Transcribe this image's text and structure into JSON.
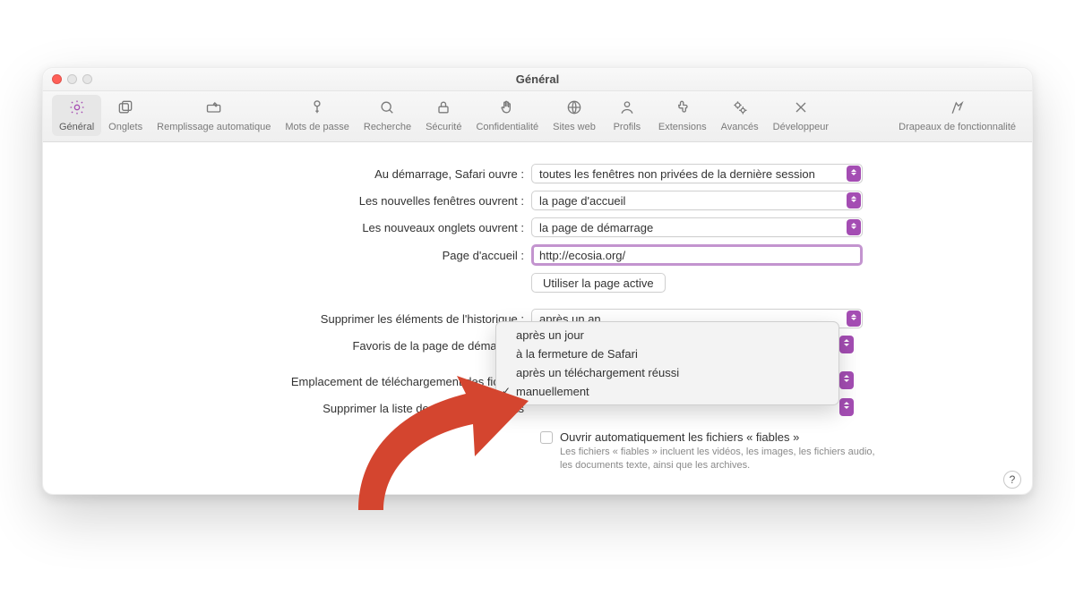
{
  "window": {
    "title": "Général"
  },
  "toolbar": {
    "items": [
      {
        "label": "Général"
      },
      {
        "label": "Onglets"
      },
      {
        "label": "Remplissage automatique"
      },
      {
        "label": "Mots de passe"
      },
      {
        "label": "Recherche"
      },
      {
        "label": "Sécurité"
      },
      {
        "label": "Confidentialité"
      },
      {
        "label": "Sites web"
      },
      {
        "label": "Profils"
      },
      {
        "label": "Extensions"
      },
      {
        "label": "Avancés"
      },
      {
        "label": "Développeur"
      },
      {
        "label": "Drapeaux de fonctionnalité"
      }
    ]
  },
  "settings": {
    "startup_label": "Au démarrage, Safari ouvre :",
    "startup_value": "toutes les fenêtres non privées de la dernière session",
    "new_windows_label": "Les nouvelles fenêtres ouvrent :",
    "new_windows_value": "la page d'accueil",
    "new_tabs_label": "Les nouveaux onglets ouvrent :",
    "new_tabs_value": "la page de démarrage",
    "homepage_label": "Page d'accueil :",
    "homepage_value": "http://ecosia.org/",
    "use_current_btn": "Utiliser la page active",
    "history_label": "Supprimer les éléments de l'historique :",
    "history_value": "après un an",
    "favorites_label": "Favoris de la page de démarrage",
    "download_loc_label": "Emplacement de téléchargement des fichiers",
    "download_clear_label": "Supprimer la liste des téléchargements",
    "safe_open_label": "Ouvrir automatiquement les fichiers « fiables »",
    "safe_open_hint": "Les fichiers « fiables » incluent les vidéos, les images, les fichiers audio, les documents texte, ainsi que les archives."
  },
  "dropdown": {
    "options": [
      {
        "label": "après un jour",
        "selected": false
      },
      {
        "label": "à la fermeture de Safari",
        "selected": false
      },
      {
        "label": "après un téléchargement réussi",
        "selected": false
      },
      {
        "label": "manuellement",
        "selected": true
      }
    ]
  },
  "help": "?"
}
